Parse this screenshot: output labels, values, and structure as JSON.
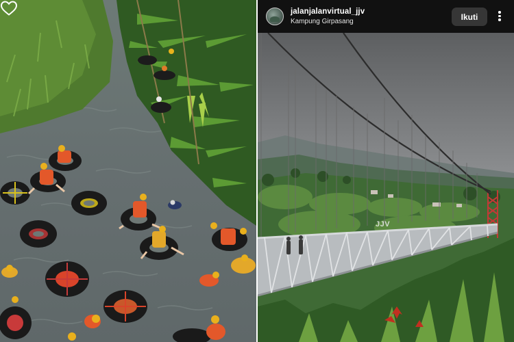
{
  "post": {
    "username": "jalanjalanvirtual_jjv",
    "location": "Kampung Girpasang",
    "follow_label": "Ikuti",
    "more_icon": "more-vertical-icon",
    "like_icon": "heart-outline-icon"
  },
  "photos": {
    "left": "river-tubing-photo",
    "right": "suspension-bridge-photo",
    "bridge_sign": "JJV"
  },
  "colors": {
    "header_bg": "#111111",
    "follow_button_bg": "#363636",
    "text": "#ffffff"
  }
}
